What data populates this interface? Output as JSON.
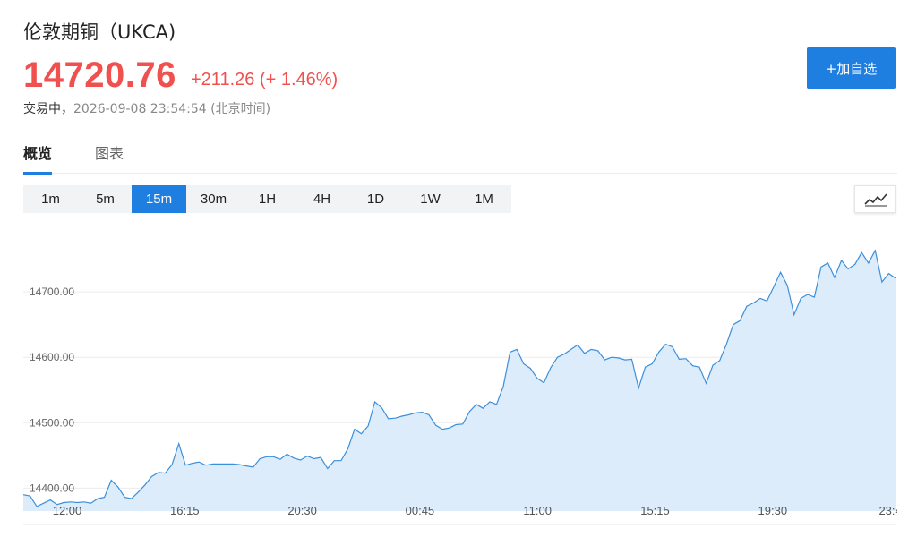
{
  "header": {
    "title": "伦敦期铜（UKCA)",
    "price": "14720.76",
    "change": "+211.26 (+ 1.46%)",
    "status_label": "交易中，",
    "status_time": "2026-09-08 23:54:54 (北京时间)",
    "add_button": "+加自选"
  },
  "tabs": [
    {
      "label": "概览",
      "active": true
    },
    {
      "label": "图表",
      "active": false
    }
  ],
  "periods": [
    {
      "label": "1m",
      "active": false
    },
    {
      "label": "5m",
      "active": false
    },
    {
      "label": "15m",
      "active": true
    },
    {
      "label": "30m",
      "active": false
    },
    {
      "label": "1H",
      "active": false
    },
    {
      "label": "4H",
      "active": false
    },
    {
      "label": "1D",
      "active": false
    },
    {
      "label": "1W",
      "active": false
    },
    {
      "label": "1M",
      "active": false
    }
  ],
  "chart_type_icon": "line-chart-icon",
  "colors": {
    "up": "#f0514f",
    "accent": "#1f7fe0",
    "line": "#3b8fdb",
    "fill": "#dcecfb"
  },
  "chart_data": {
    "type": "area",
    "title": "",
    "xlabel": "",
    "ylabel": "",
    "ylim": [
      14365,
      14800
    ],
    "yticks": [
      14400.0,
      14500.0,
      14600.0,
      14700.0
    ],
    "ytick_labels": [
      "14400.00",
      "14500.00",
      "14600.00",
      "14700.00"
    ],
    "xtick_labels": [
      "12:00",
      "16:15",
      "20:30",
      "00:45",
      "11:00",
      "15:15",
      "19:30",
      "23:4"
    ],
    "grid": true,
    "legend": "none",
    "series": [
      {
        "values": [
          14390,
          14388,
          14372,
          14377,
          14382,
          14375,
          14378,
          14379,
          14378,
          14379,
          14377,
          14384,
          14386,
          14412,
          14402,
          14386,
          14384,
          14394,
          14405,
          14418,
          14424,
          14423,
          14436,
          14468,
          14435,
          14438,
          14440,
          14435,
          14437,
          14437,
          14437,
          14437,
          14436,
          14434,
          14432,
          14445,
          14448,
          14448,
          14444,
          14452,
          14446,
          14443,
          14449,
          14445,
          14447,
          14430,
          14442,
          14442,
          14460,
          14490,
          14483,
          14495,
          14532,
          14523,
          14506,
          14507,
          14510,
          14512,
          14515,
          14516,
          14512,
          14496,
          14490,
          14492,
          14497,
          14498,
          14517,
          14528,
          14522,
          14532,
          14528,
          14556,
          14608,
          14612,
          14590,
          14583,
          14568,
          14561,
          14584,
          14600,
          14605,
          14612,
          14619,
          14606,
          14612,
          14610,
          14596,
          14600,
          14599,
          14596,
          14597,
          14553,
          14585,
          14590,
          14608,
          14620,
          14616,
          14597,
          14598,
          14587,
          14585,
          14560,
          14588,
          14595,
          14620,
          14650,
          14656,
          14678,
          14683,
          14690,
          14686,
          14708,
          14730,
          14710,
          14665,
          14690,
          14696,
          14692,
          14738,
          14744,
          14722,
          14748,
          14735,
          14742,
          14760,
          14744,
          14763,
          14715,
          14728,
          14721
        ]
      }
    ]
  }
}
